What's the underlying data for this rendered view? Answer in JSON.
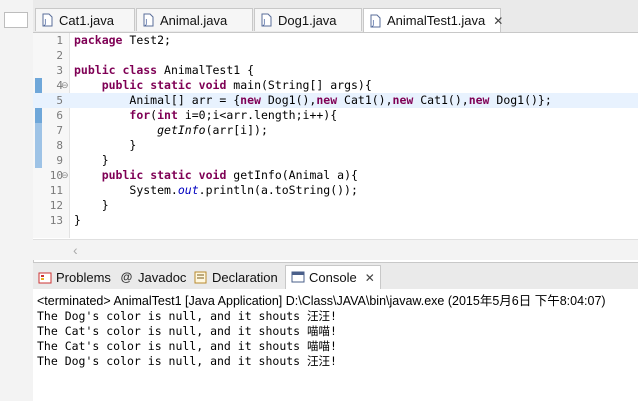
{
  "editor_tabs": [
    {
      "label": "Cat1.java",
      "active": false
    },
    {
      "label": "Animal.java",
      "active": false
    },
    {
      "label": "Dog1.java",
      "active": false
    },
    {
      "label": "AnimalTest1.java",
      "active": true
    }
  ],
  "editor": {
    "line_numbers": [
      "1",
      "2",
      "3",
      "4",
      "5",
      "6",
      "7",
      "8",
      "9",
      "10",
      "11",
      "12",
      "13"
    ],
    "code": {
      "l1_kw": "package",
      "l1_rest": " Test2;",
      "l3_kw1": "public",
      "l3_kw2": "class",
      "l3_rest": " AnimalTest1 {",
      "l4_kw1": "public",
      "l4_kw2": "static",
      "l4_kw3": "void",
      "l4_rest": " main(String[] args){",
      "l5_a": "Animal[] arr = {",
      "l5_new1": "new",
      "l5_b": " Dog1(),",
      "l5_new2": "new",
      "l5_c": " Cat1(),",
      "l5_new3": "new",
      "l5_d": " Cat1(),",
      "l5_new4": "new",
      "l5_e": " Dog1()};",
      "l6_kw1": "for",
      "l6_a": "(",
      "l6_kw2": "int",
      "l6_b": " i=0;i<arr.length;i++){",
      "l7_call": "getInfo",
      "l7_rest": "(arr[i]);",
      "l8": "}",
      "l9": "}",
      "l10_kw1": "public",
      "l10_kw2": "static",
      "l10_kw3": "void",
      "l10_rest": " getInfo(Animal a){",
      "l11_a": "System.",
      "l11_field": "out",
      "l11_b": ".println(a.toString());",
      "l12": "}",
      "l13": "}"
    }
  },
  "panel_tabs": [
    {
      "label": "Problems",
      "icon": "problems-icon",
      "active": false
    },
    {
      "label": "Javadoc",
      "icon": "javadoc-icon",
      "active": false
    },
    {
      "label": "Declaration",
      "icon": "declaration-icon",
      "active": false
    },
    {
      "label": "Console",
      "icon": "console-icon",
      "active": true
    }
  ],
  "console": {
    "terminated": "<terminated> AnimalTest1 [Java Application] D:\\Class\\JAVA\\bin\\javaw.exe (2015年5月6日 下午8:04:07)",
    "lines": [
      "The Dog's color is null, and it shouts 汪汪!",
      "The Cat's color is null, and it shouts 喵喵!",
      "The Cat's color is null, and it shouts 喵喵!",
      "The Dog's color is null, and it shouts 汪汪!"
    ]
  },
  "colors": {
    "keyword": "#7f0055",
    "field": "#0000c0",
    "current_line": "#e8f2fe"
  }
}
